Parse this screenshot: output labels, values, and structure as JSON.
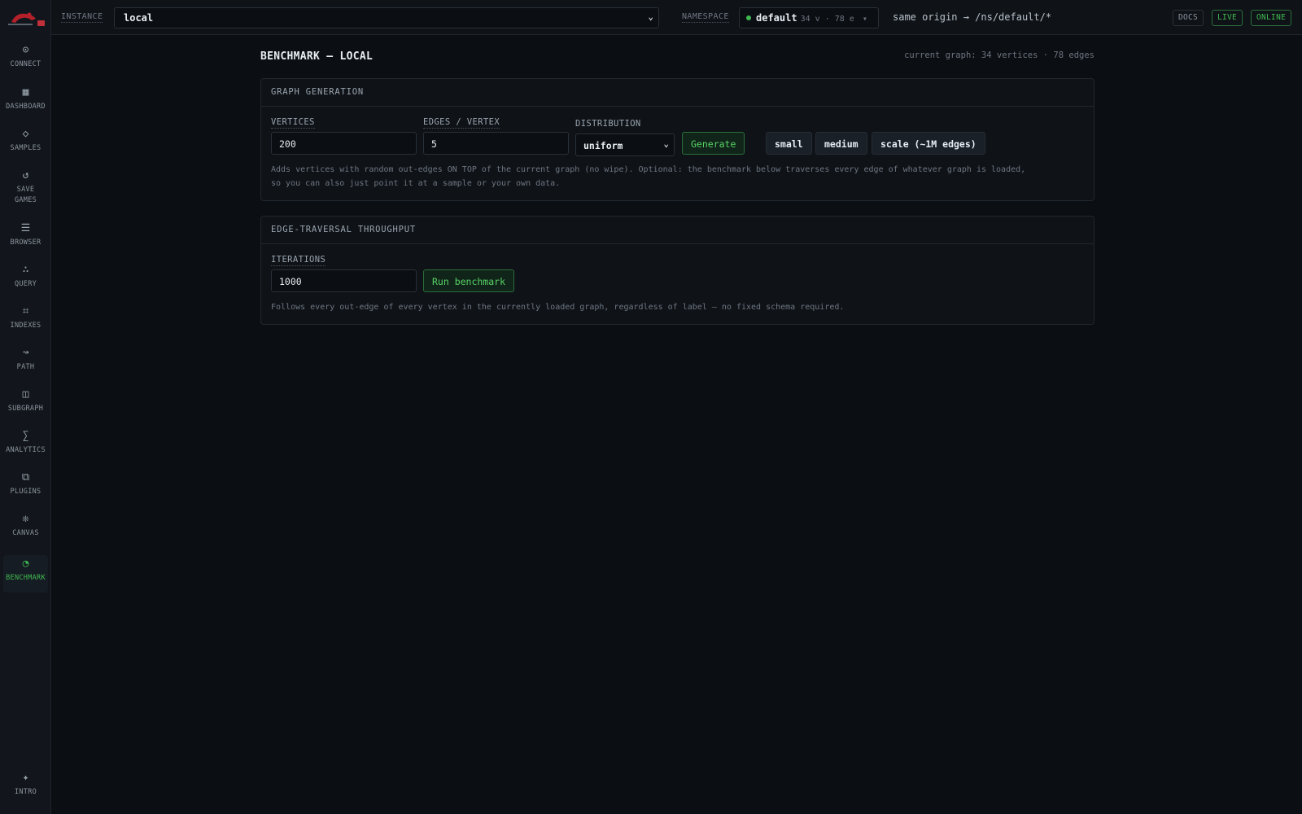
{
  "sidebar": {
    "items": [
      {
        "icon": "target-icon",
        "glyph": "⊙",
        "label": "CONNECT"
      },
      {
        "icon": "grid-icon",
        "glyph": "▦",
        "label": "DASHBOARD"
      },
      {
        "icon": "diamond-icon",
        "glyph": "◇",
        "label": "SAMPLES"
      },
      {
        "icon": "refresh-icon",
        "glyph": "↺",
        "label": "SAVE GAMES"
      },
      {
        "icon": "list-icon",
        "glyph": "☰",
        "label": "BROWSER"
      },
      {
        "icon": "dots-icon",
        "glyph": "∴",
        "label": "QUERY"
      },
      {
        "icon": "frame-icon",
        "glyph": "⌗",
        "label": "INDEXES"
      },
      {
        "icon": "wave-arrow-icon",
        "glyph": "↝",
        "label": "PATH"
      },
      {
        "icon": "split-box-icon",
        "glyph": "◫",
        "label": "SUBGRAPH"
      },
      {
        "icon": "sigma-icon",
        "glyph": "∑",
        "label": "ANALYTICS"
      },
      {
        "icon": "stack-squares-icon",
        "glyph": "⧉",
        "label": "PLUGINS"
      },
      {
        "icon": "flower-icon",
        "glyph": "❊",
        "label": "CANVAS"
      },
      {
        "icon": "pie-icon",
        "glyph": "◔",
        "label": "BENCHMARK"
      }
    ],
    "intro": {
      "icon": "sparkle-icon",
      "glyph": "✦",
      "label": "INTRO"
    }
  },
  "topbar": {
    "instance_label": "INSTANCE",
    "instance_value": "local",
    "namespace_label": "NAMESPACE",
    "namespace_name": "default",
    "namespace_counts": "34 v · 78 e",
    "origin": "same origin → /ns/default/*",
    "docs": "DOCS",
    "live": "LIVE",
    "online": "ONLINE"
  },
  "page": {
    "title": "BENCHMARK — LOCAL",
    "graph_info": "current graph: 34 vertices · 78 edges"
  },
  "generation": {
    "heading": "GRAPH GENERATION",
    "vertices_label": "VERTICES",
    "vertices_value": "200",
    "edges_label": "EDGES / VERTEX",
    "edges_value": "5",
    "distribution_label": "DISTRIBUTION",
    "distribution_value": "uniform",
    "generate": "Generate",
    "presets": [
      "small",
      "medium",
      "scale (~1M edges)"
    ],
    "note_line1": "Adds vertices with random out-edges ON TOP of the current graph (no wipe). Optional: the benchmark below traverses every edge of whatever graph is loaded,",
    "note_line2": "so you can also just point it at a sample or your own data."
  },
  "throughput": {
    "heading": "EDGE-TRAVERSAL THROUGHPUT",
    "iterations_label": "ITERATIONS",
    "iterations_value": "1000",
    "run": "Run benchmark",
    "note": "Follows every out-edge of every vertex in the currently loaded graph, regardless of label — no fixed schema required."
  },
  "colors": {
    "accent": "#3fb950",
    "background": "#0b0e12",
    "panel": "#0f1318"
  }
}
